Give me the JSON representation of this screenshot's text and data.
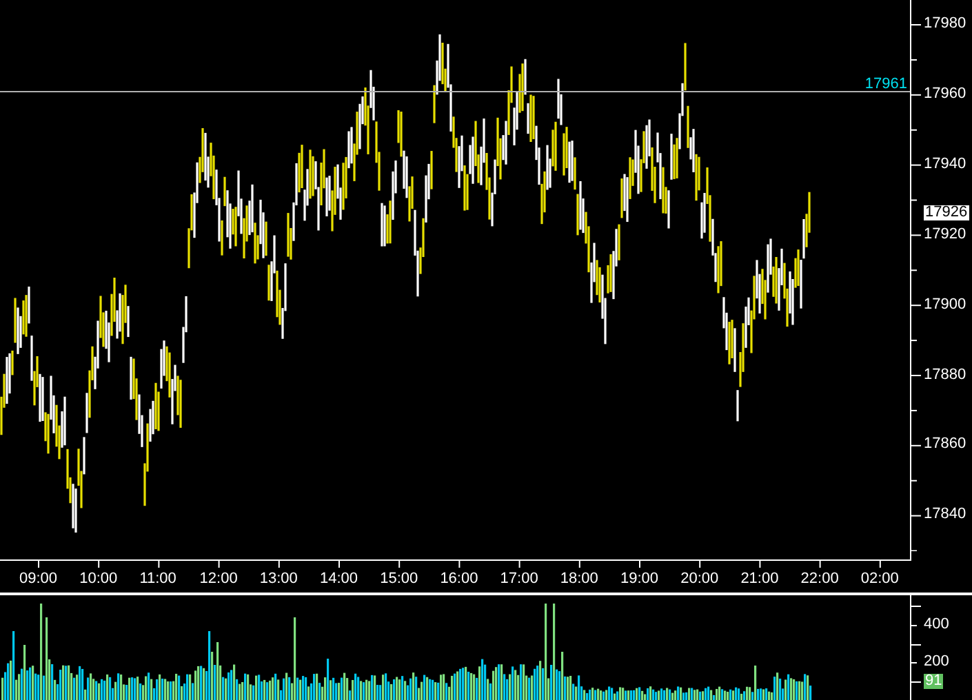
{
  "price_panel": {
    "y_axis_labels": [
      "17980",
      "17960",
      "17940",
      "17920",
      "17900",
      "17880",
      "17860",
      "17840"
    ],
    "reference_line": {
      "label": "17961"
    },
    "last_price": "17926"
  },
  "time_axis": {
    "labels": [
      "09:00",
      "10:00",
      "11:00",
      "12:00",
      "13:00",
      "14:00",
      "15:00",
      "16:00",
      "17:00",
      "18:00",
      "19:00",
      "20:00",
      "21:00",
      "22:00",
      "02:00"
    ]
  },
  "volume_panel": {
    "y_axis_labels": [
      "400",
      "200"
    ],
    "last_volume": "91"
  }
}
